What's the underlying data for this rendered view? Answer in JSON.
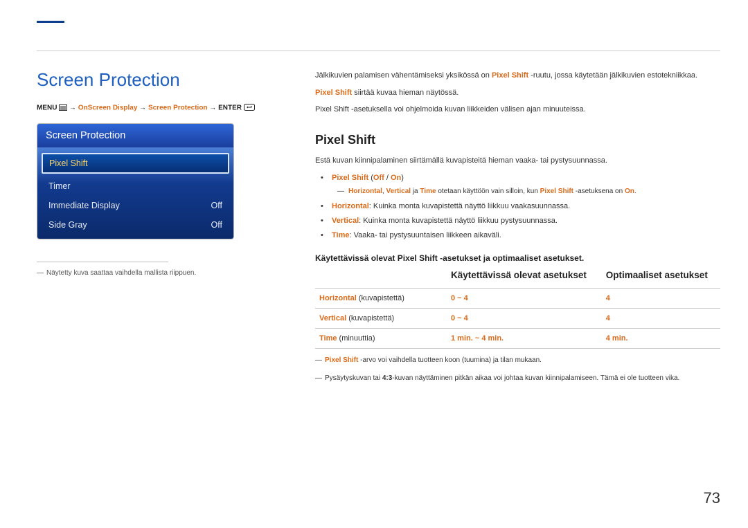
{
  "page_number": "73",
  "left": {
    "h1": "Screen Protection",
    "breadcrumb": {
      "menu": "MENU",
      "arrow": " → ",
      "p1": "OnScreen Display",
      "p2": "Screen Protection",
      "enter": "ENTER"
    },
    "osd": {
      "title": "Screen Protection",
      "rows": [
        {
          "label": "Pixel Shift",
          "value": ""
        },
        {
          "label": "Timer",
          "value": ""
        },
        {
          "label": "Immediate Display",
          "value": "Off"
        },
        {
          "label": "Side Gray",
          "value": "Off"
        }
      ]
    },
    "footnote": "Näytetty kuva saattaa vaihdella mallista riippuen."
  },
  "right": {
    "intro1_a": "Jälkikuvien palamisen vähentämiseksi yksikössä on ",
    "intro1_b": "Pixel Shift",
    "intro1_c": " -ruutu, jossa käytetään jälkikuvien estotekniikkaa.",
    "intro2_a": "Pixel Shift",
    "intro2_b": " siirtää kuvaa hieman näytössä.",
    "intro3": "Pixel Shift -asetuksella voi ohjelmoida kuvan liikkeiden välisen ajan minuuteissa.",
    "section_title": "Pixel Shift",
    "desc": "Estä kuvan kiinnipalaminen siirtämällä kuvapisteitä hieman vaaka- tai pystysuunnassa.",
    "bullets": {
      "b1_a": "Pixel Shift",
      "b1_b": " (",
      "b1_c": "Off",
      "b1_d": " / ",
      "b1_e": "On",
      "b1_f": ")",
      "sub_a1": "Horizontal",
      "sub_a2": ", ",
      "sub_a3": "Vertical",
      "sub_a4": " ja ",
      "sub_a5": "Time",
      "sub_a6": " otetaan käyttöön vain silloin, kun ",
      "sub_a7": "Pixel Shift",
      "sub_a8": " -asetuksena on ",
      "sub_a9": "On",
      "sub_a10": ".",
      "b2_a": "Horizontal",
      "b2_b": ": Kuinka monta kuvapistettä näyttö liikkuu vaakasuunnassa.",
      "b3_a": "Vertical",
      "b3_b": ": Kuinka monta kuvapistettä näyttö liikkuu pystysuunnassa.",
      "b4_a": "Time",
      "b4_b": ": Vaaka- tai pystysuuntaisen liikkeen aikaväli."
    },
    "subtitle": "Käytettävissä olevat Pixel Shift -asetukset ja optimaaliset asetukset.",
    "table": {
      "h1": "",
      "h2": "Käytettävissä olevat asetukset",
      "h3": "Optimaaliset asetukset",
      "rows": [
        {
          "label": "Horizontal",
          "unit": " (kuvapistettä)",
          "range": "0 ~ 4",
          "opt": "4"
        },
        {
          "label": "Vertical",
          "unit": " (kuvapistettä)",
          "range": "0 ~ 4",
          "opt": "4"
        },
        {
          "label": "Time",
          "unit": " (minuuttia)",
          "range": "1 min. ~ 4 min.",
          "opt": "4 min."
        }
      ]
    },
    "end1_a": "Pixel Shift",
    "end1_b": " -arvo voi vaihdella tuotteen koon (tuumina) ja tilan mukaan.",
    "end2_a": "Pysäytyskuvan tai ",
    "end2_b": "4:3",
    "end2_c": "-kuvan näyttäminen pitkän aikaa voi johtaa kuvan kiinnipalamiseen. Tämä ei ole tuotteen vika."
  }
}
